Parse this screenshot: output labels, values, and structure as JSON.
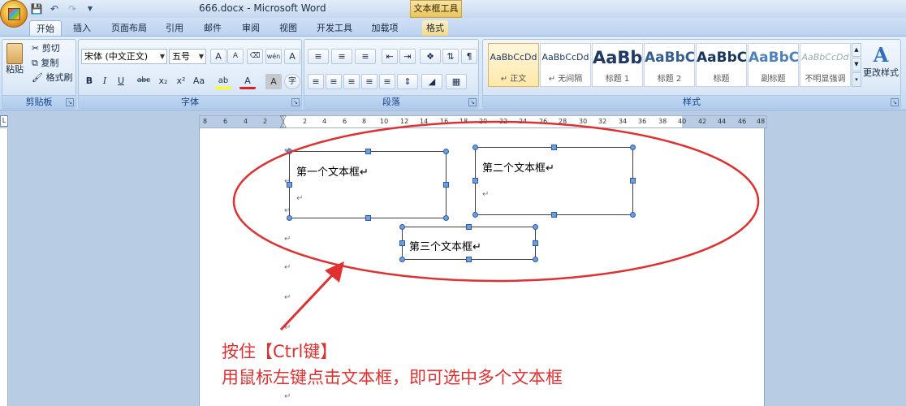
{
  "titlebar": {
    "doc_title": "666.docx - Microsoft Word",
    "context_tab_title": "文本框工具"
  },
  "qat": {
    "save_icon": "save-icon",
    "undo_icon": "undo-icon",
    "redo_icon": "redo-icon",
    "customize_icon": "chevron-down-icon"
  },
  "tabs": [
    "开始",
    "插入",
    "页面布局",
    "引用",
    "邮件",
    "审阅",
    "视图",
    "开发工具",
    "加载项",
    "格式"
  ],
  "active_tab": "开始",
  "clipboard": {
    "paste": "粘贴",
    "cut": "剪切",
    "copy": "复制",
    "format_painter": "格式刷",
    "label": "剪贴板"
  },
  "font": {
    "font_name": "宋体 (中文正文)",
    "font_size": "五号",
    "label": "字体",
    "bold": "B",
    "italic": "I",
    "underline": "U",
    "strike": "abc",
    "subscript": "x₂",
    "superscript": "x²",
    "change_case": "Aa",
    "grow": "A",
    "shrink": "A",
    "text_color": "A",
    "highlight": "ab",
    "char_border": "A",
    "char_shade": "A",
    "phonetic": "wén",
    "enclose": "字"
  },
  "paragraph": {
    "label": "段落"
  },
  "styles": {
    "label": "样式",
    "items": [
      {
        "preview": "AaBbCcDd",
        "name": "↵ 正文"
      },
      {
        "preview": "AaBbCcDd",
        "name": "↵ 无间隔"
      },
      {
        "preview": "AaBb",
        "name": "标题 1"
      },
      {
        "preview": "AaBbC",
        "name": "标题 2"
      },
      {
        "preview": "AaBbC",
        "name": "标题"
      },
      {
        "preview": "AaBbC",
        "name": "副标题"
      },
      {
        "preview": "AaBbCcDd",
        "name": "不明显强调"
      }
    ],
    "change_styles": "更改样式"
  },
  "ruler": {
    "left_numbers": [
      "8",
      "6",
      "4",
      "2"
    ],
    "right_numbers": [
      "2",
      "4",
      "6",
      "8",
      "10",
      "12",
      "14",
      "16",
      "18",
      "20",
      "22",
      "24",
      "26",
      "28",
      "30",
      "32",
      "34",
      "36",
      "38",
      "40",
      "42",
      "44",
      "46",
      "48"
    ]
  },
  "document": {
    "textbox1": "第一个文本框↵",
    "textbox2": "第二个文本框↵",
    "textbox3": "第三个文本框↵",
    "para_mark": "↵"
  },
  "annotation": {
    "line1": "按住【Ctrl键】",
    "line2": "用鼠标左键点击文本框，即可选中多个文本框"
  },
  "colors": {
    "annotation": "#e03030",
    "ribbon_bg": "#d6e5f6",
    "accent": "#15428b"
  }
}
